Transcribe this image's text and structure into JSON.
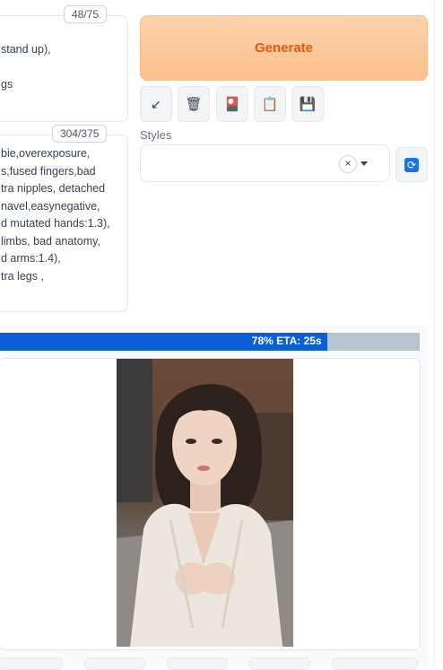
{
  "prompt": {
    "counter": "48/75",
    "lines": [
      "stand up),",
      "",
      "gs"
    ]
  },
  "negative_prompt": {
    "counter": "304/375",
    "lines": [
      "bie,overexposure,",
      "s,fused fingers,bad",
      "tra nipples, detached",
      "navel,easynegative,",
      "d mutated hands:1.3),",
      "limbs, bad anatomy,",
      "d arms:1.4),",
      "tra legs ,"
    ]
  },
  "generate_label": "Generate",
  "tools": [
    {
      "name": "arrow-icon",
      "glyph": "↙"
    },
    {
      "name": "trash-icon",
      "glyph": "🗑"
    },
    {
      "name": "red-card-icon",
      "glyph": "🎴"
    },
    {
      "name": "clipboard-icon",
      "glyph": "📋"
    },
    {
      "name": "save-icon",
      "glyph": "💾"
    }
  ],
  "styles": {
    "label": "Styles",
    "clear": "×",
    "refresh_glyph": "⟳"
  },
  "progress": {
    "fraction": 0.78,
    "text": "78% ETA: 25s"
  },
  "colors": {
    "accent": "#ea580c",
    "progress": "#0a5fd7"
  }
}
